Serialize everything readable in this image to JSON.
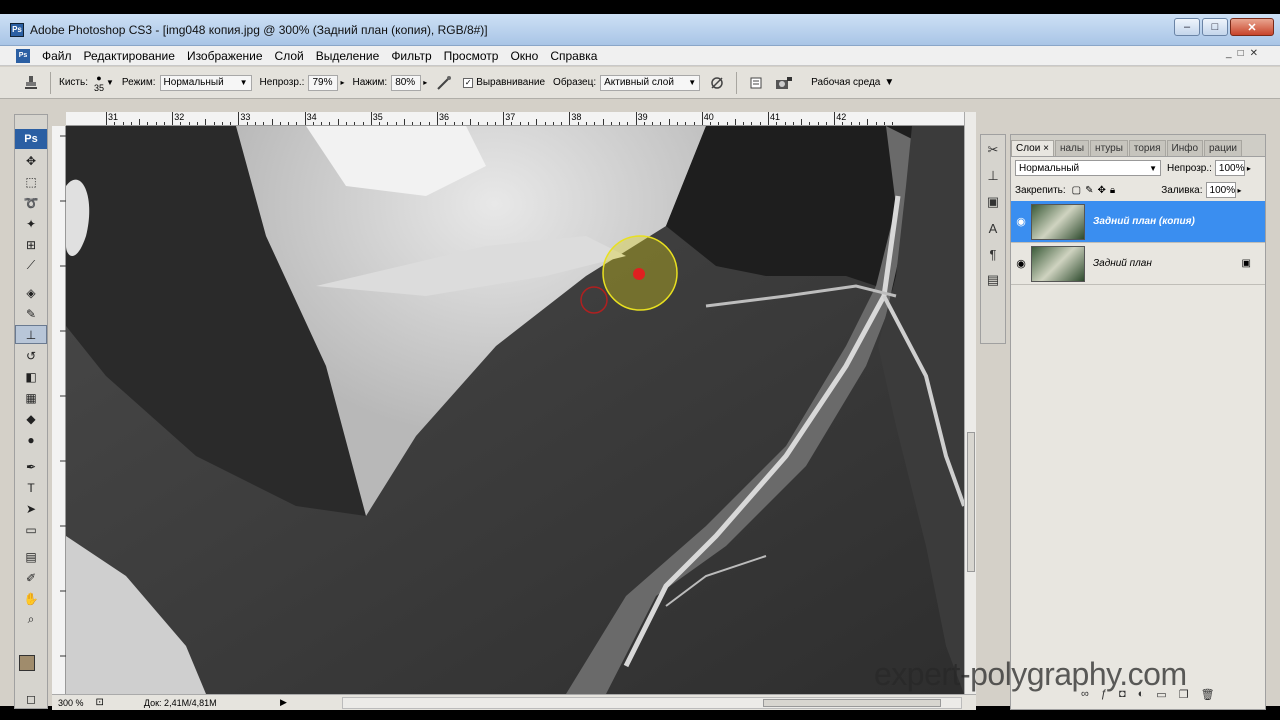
{
  "window": {
    "title": "Adobe Photoshop CS3 - [img048 копия.jpg @ 300% (Задний план (копия), RGB/8#)]",
    "app_badge": "Ps",
    "minimize": "–",
    "maximize": "□",
    "close": "✕"
  },
  "menu": {
    "items": [
      "Файл",
      "Редактирование",
      "Изображение",
      "Слой",
      "Выделение",
      "Фильтр",
      "Просмотр",
      "Окно",
      "Справка"
    ],
    "doc_min": "_",
    "doc_max": "□",
    "doc_close": "✕"
  },
  "options": {
    "brush_label": "Кисть:",
    "brush_size": "35",
    "mode_label": "Режим:",
    "mode_value": "Нормальный",
    "opacity_label": "Непрозр.:",
    "opacity_value": "79%",
    "flow_label": "Нажим:",
    "flow_value": "80%",
    "align_label": "Выравнивание",
    "align_checked": "✓",
    "sample_label": "Образец:",
    "sample_value": "Активный слой",
    "workspace_label": "Рабочая среда"
  },
  "ruler": {
    "ticks": [
      "31",
      "32",
      "33",
      "34",
      "35",
      "36",
      "37",
      "38",
      "39",
      "40",
      "41",
      "42"
    ]
  },
  "toolbox": {
    "logo": "Ps"
  },
  "status": {
    "zoom": "300 %",
    "doc_info": "Док: 2,41M/4,81M"
  },
  "layers_panel": {
    "tabs": [
      "Слои ×",
      "налы",
      "нтуры",
      "тория",
      "Инфо",
      "рации"
    ],
    "blend_mode": "Нормальный",
    "opacity_label": "Непрозр.:",
    "opacity_value": "100%",
    "lock_label": "Закрепить:",
    "fill_label": "Заливка:",
    "fill_value": "100%",
    "layers": [
      {
        "name": "Задний план (копия)",
        "selected": true
      },
      {
        "name": "Задний план",
        "selected": false
      }
    ]
  },
  "watermark": "expert-polygraphy.com",
  "colors": {
    "accent": "#3a8ef0",
    "foreground_swatch": "#a08c6c",
    "brush_circle": "#e8e020",
    "sample_point": "#e02020"
  }
}
